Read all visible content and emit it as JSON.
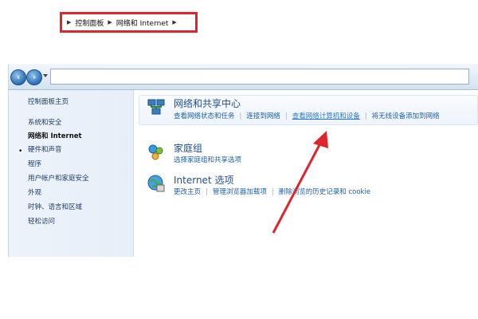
{
  "addressbar": {
    "breadcrumbs": [
      "控制面板",
      "网络和 Internet"
    ],
    "back_icon": "back-arrow-icon",
    "forward_icon": "forward-arrow-icon"
  },
  "sidebar": {
    "home": "控制面板主页",
    "items": [
      {
        "label": "系统和安全",
        "current": false
      },
      {
        "label": "网络和 Internet",
        "current": true
      },
      {
        "label": "硬件和声音",
        "current": false
      },
      {
        "label": "程序",
        "current": false
      },
      {
        "label": "用户帐户和家庭安全",
        "current": false
      },
      {
        "label": "外观",
        "current": false
      },
      {
        "label": "时钟、语言和区域",
        "current": false
      },
      {
        "label": "轻松访问",
        "current": false
      }
    ]
  },
  "categories": [
    {
      "title": "网络和共享中心",
      "icon": "network-sharing-center-icon",
      "links": [
        "查看网络状态和任务",
        "连接到网络",
        "查看网络计算机和设备",
        "将无线设备添加到网络"
      ]
    },
    {
      "title": "家庭组",
      "icon": "homegroup-icon",
      "links": [
        "选择家庭组和共享选项"
      ]
    },
    {
      "title": "Internet 选项",
      "icon": "internet-options-icon",
      "links": [
        "更改主页",
        "管理浏览器加载项",
        "删除浏览的历史记录和 cookie"
      ]
    }
  ],
  "annotation": {
    "color": "#e0242b"
  }
}
